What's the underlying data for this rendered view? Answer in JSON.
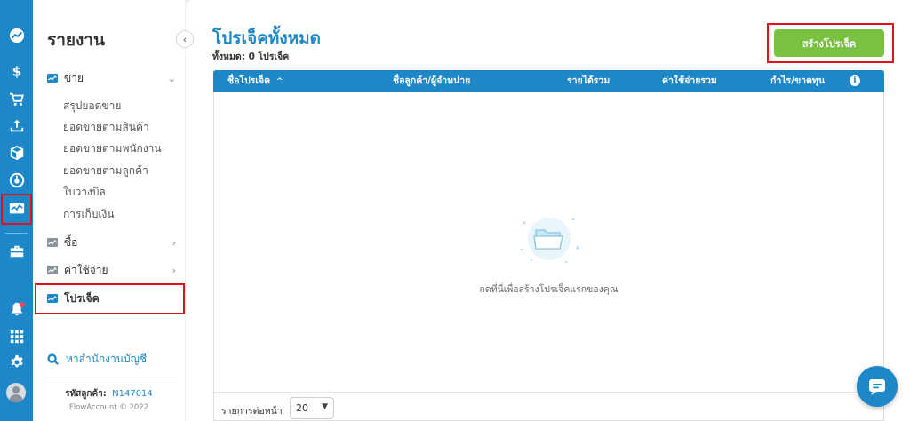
{
  "colors": {
    "brand": "#1d87c8",
    "create_button": "#7ac142",
    "highlight": "#e0111e"
  },
  "rail": {
    "icons": [
      "trend-icon",
      "dollar-icon",
      "cart-icon",
      "upload-tray-icon",
      "box-icon",
      "gauge-icon",
      "report-icon",
      "briefcase-icon",
      "bell-icon",
      "apps-grid-icon",
      "gear-icon",
      "avatar"
    ]
  },
  "sidebar": {
    "title": "รายงาน",
    "sections": {
      "sales": {
        "label": "ขาย"
      },
      "purchase": {
        "label": "ซื้อ"
      },
      "expense": {
        "label": "ค่าใช้จ่าย"
      },
      "project": {
        "label": "โปรเจ็ค"
      }
    },
    "sales_items": [
      "สรุปยอดขาย",
      "ยอดขายตามสินค้า",
      "ยอดขายตามพนักงาน",
      "ยอดขายตามลูกค้า",
      "ใบวางบิล",
      "การเก็บเงิน"
    ],
    "search_accountant": "หาสำนักงานบัญชี",
    "customer_id_label": "รหัสลูกค้า:",
    "customer_id_value": "N147014",
    "copyright": "FlowAccount © 2022"
  },
  "main": {
    "title": "โปรเจ็คทั้งหมด",
    "count_text": "ทั้งหมด: 0 โปรเจ็ค",
    "create_button": "สร้างโปรเจ็ค",
    "table": {
      "columns": [
        "ชื่อโปรเจ็ค",
        "ชื่อลูกค้า/ผู้จำหน่าย",
        "รายได้รวม",
        "ค่าใช้จ่ายรวม",
        "กำไร/ขาดทุน"
      ],
      "sort_indicator": "^",
      "info_icon": "i",
      "empty_text": "กดที่นี่เพื่อสร้างโปรเจ็คแรกของคุณ",
      "per_page_label": "รายการต่อหน้า",
      "per_page_value": "20"
    }
  }
}
